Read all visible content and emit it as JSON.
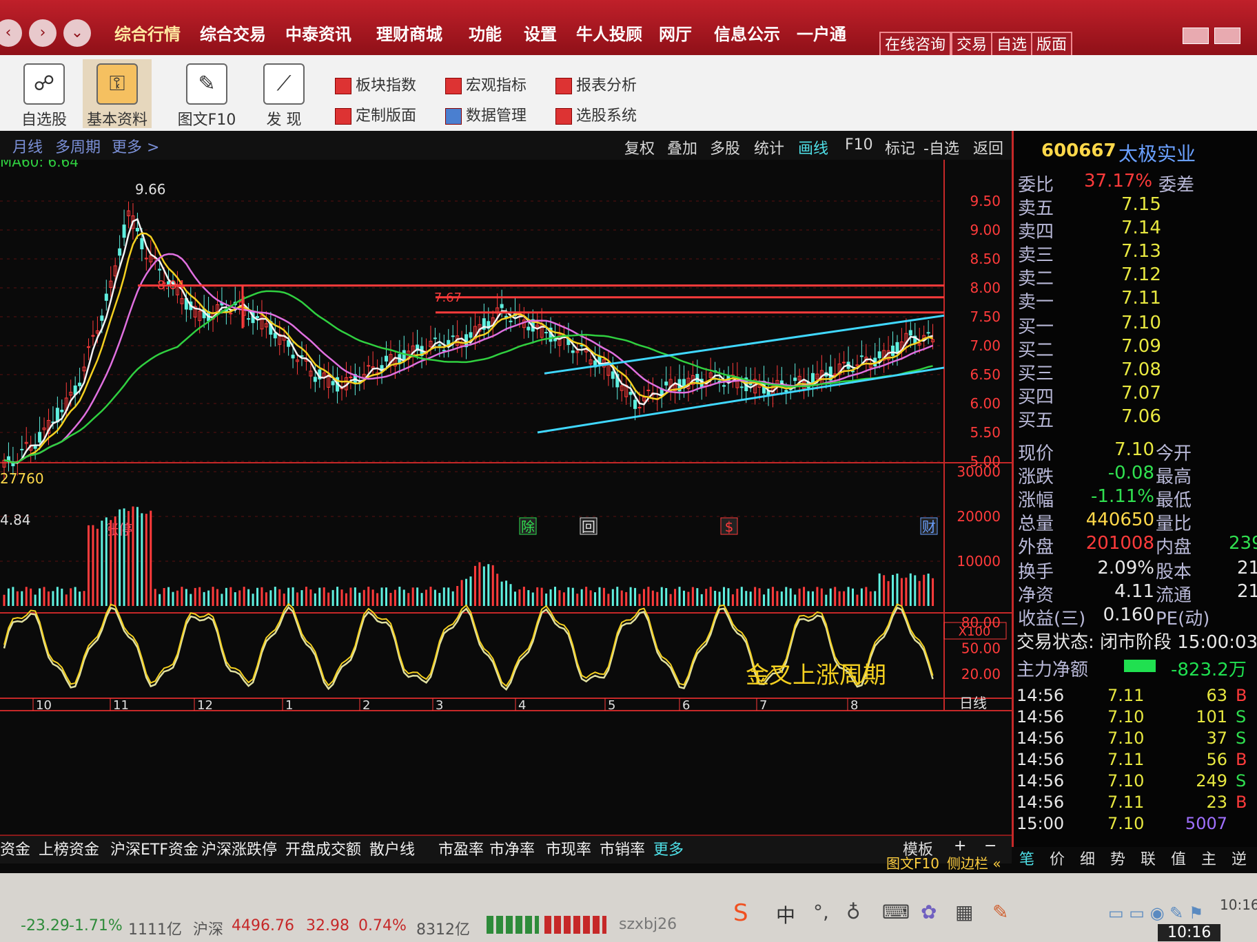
{
  "menu": {
    "items": [
      "综合行情",
      "综合交易",
      "中泰资讯",
      "理财商城",
      "功能",
      "设置",
      "牛人投顾",
      "网厅",
      "信息公示",
      "一户通"
    ],
    "right_buttons": [
      "在线咨询",
      "交易",
      "自选",
      "版面"
    ]
  },
  "toolbar": {
    "big": [
      "自选股",
      "基本资料",
      "图文F10",
      "发 现"
    ],
    "small_row1": [
      "板块指数",
      "宏观指标",
      "报表分析"
    ],
    "small_row2": [
      "定制版面",
      "数据管理",
      "选股系统"
    ]
  },
  "chart_header": {
    "left": [
      "月线",
      "多周期",
      "更多 >"
    ],
    "buttons": [
      "复权",
      "叠加",
      "多股",
      "统计",
      "画线",
      "F10",
      "标记",
      "-自选",
      "返回"
    ],
    "active": "画线"
  },
  "indicator_labels": {
    "ma60": "MA60: 6.64",
    "high_mark": "9.66",
    "mid_mark1": "8.04",
    "mid_mark2": "7.67",
    "low_mark": "4.84",
    "vol_label": "27760",
    "flag_left": "涨停",
    "events": [
      "除",
      "回",
      "$",
      "财"
    ],
    "x100": "X100",
    "period": "日线",
    "overlay_text": "金叉上涨周期"
  },
  "price_axis": [
    "9.50",
    "9.00",
    "8.50",
    "8.00",
    "7.50",
    "7.00",
    "6.50",
    "6.00",
    "5.50",
    "5.00"
  ],
  "volume_axis": [
    "30000",
    "20000",
    "10000"
  ],
  "osc_axis": [
    "80.00",
    "50.00",
    "20.00"
  ],
  "months": [
    "10",
    "11",
    "12",
    "1",
    "2",
    "3",
    "4",
    "5",
    "6",
    "7",
    "8"
  ],
  "stock": {
    "code": "600667",
    "name": "太极实业"
  },
  "orderbook": {
    "ratio_label": "委比",
    "ratio": "37.17%",
    "diff_label": "委差",
    "sells": [
      {
        "label": "卖五",
        "price": "7.15"
      },
      {
        "label": "卖四",
        "price": "7.14"
      },
      {
        "label": "卖三",
        "price": "7.13"
      },
      {
        "label": "卖二",
        "price": "7.12"
      },
      {
        "label": "卖一",
        "price": "7.11"
      }
    ],
    "buys": [
      {
        "label": "买一",
        "price": "7.10"
      },
      {
        "label": "买二",
        "price": "7.09"
      },
      {
        "label": "买三",
        "price": "7.08"
      },
      {
        "label": "买四",
        "price": "7.07"
      },
      {
        "label": "买五",
        "price": "7.06"
      }
    ]
  },
  "quote": [
    {
      "label": "现价",
      "value": "7.10",
      "label2": "今开"
    },
    {
      "label": "涨跌",
      "value": "-0.08",
      "label2": "最高"
    },
    {
      "label": "涨幅",
      "value": "-1.11%",
      "label2": "最低"
    },
    {
      "label": "总量",
      "value": "440650",
      "label2": "量比"
    },
    {
      "label": "外盘",
      "value": "201008",
      "label2": "内盘",
      "value2": "239"
    }
  ],
  "fundamentals": [
    {
      "label": "换手",
      "value": "2.09%",
      "label2": "股本",
      "value2": "21."
    },
    {
      "label": "净资",
      "value": "4.11",
      "label2": "流通",
      "value2": "21."
    },
    {
      "label": "收益(三)",
      "value": "0.160",
      "label2": "PE(动)"
    }
  ],
  "trade_status": "交易状态: 闭市阶段 15:00:03",
  "net_flow": {
    "label": "主力净额",
    "value": "-823.2万"
  },
  "ticks": [
    {
      "time": "14:56",
      "price": "7.11",
      "vol": "63",
      "side": "B"
    },
    {
      "time": "14:56",
      "price": "7.10",
      "vol": "101",
      "side": "S"
    },
    {
      "time": "14:56",
      "price": "7.10",
      "vol": "37",
      "side": "S"
    },
    {
      "time": "14:56",
      "price": "7.11",
      "vol": "56",
      "side": "B"
    },
    {
      "time": "14:56",
      "price": "7.10",
      "vol": "249",
      "side": "S"
    },
    {
      "time": "14:56",
      "price": "7.11",
      "vol": "23",
      "side": "B"
    },
    {
      "time": "15:00",
      "price": "7.10",
      "vol": "5007",
      "side": ""
    }
  ],
  "bottom_tabs": [
    "资金",
    "上榜资金",
    "沪深ETF资金",
    "沪深涨跌停",
    "开盘成交额",
    "散户线",
    "市盈率",
    "市净率",
    "市现率",
    "市销率",
    "更多"
  ],
  "bottom_right": {
    "template": "模板",
    "plus": "+",
    "minus": "−",
    "f10": "图文F10",
    "sidebar": "侧边栏 «"
  },
  "side_tabs": [
    "笔",
    "价",
    "细",
    "势",
    "联",
    "值",
    "主",
    "逆"
  ],
  "status": {
    "sh_change": "-23.29",
    "sh_pct": "-1.71%",
    "sh_amount": "1111亿",
    "sz_label": "沪深",
    "sz_index": "4496.76",
    "sz_change": "32.98",
    "sz_pct": "0.74%",
    "sz_amount": "8312亿",
    "ime_text": "szxbj26",
    "ime_lang": "中",
    "clock_small": "10:16",
    "clock": "10:16"
  },
  "colors": {
    "up": "#ff3b3b",
    "down": "#5ff0e0",
    "ma_white": "#f2f2f2",
    "ma_yellow": "#f4d020",
    "ma_violet": "#e070e0",
    "ma_green": "#30d040",
    "trend": "#40d8ff",
    "accent": "#c62828"
  }
}
